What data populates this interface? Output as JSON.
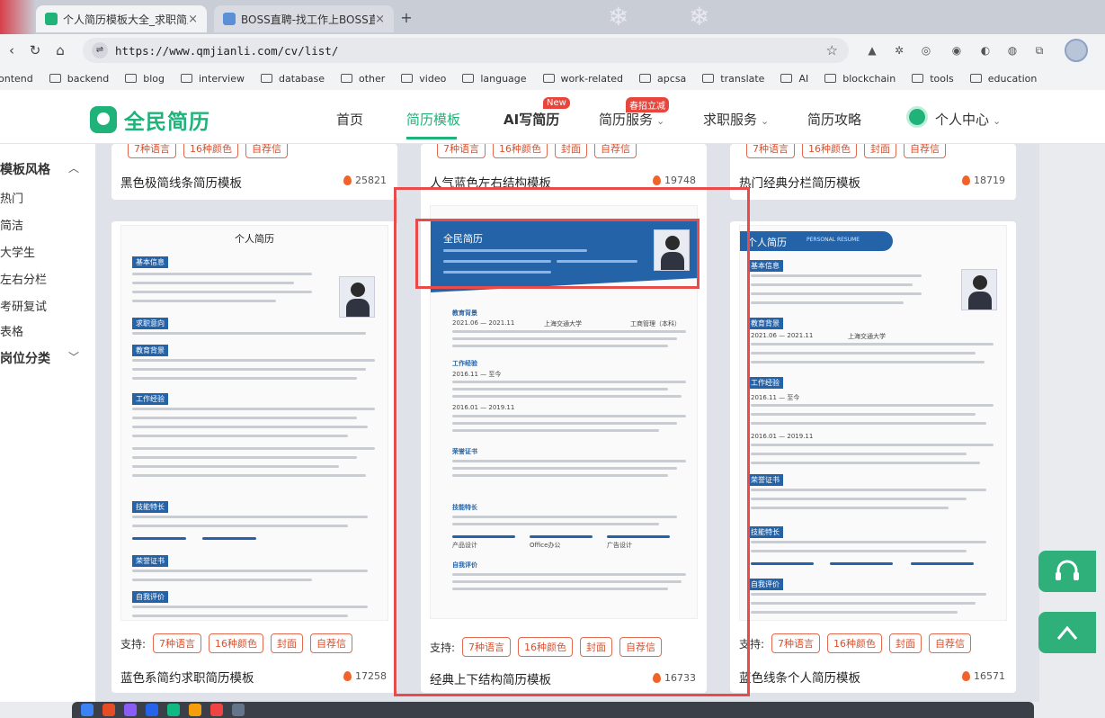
{
  "browser": {
    "tabs": [
      {
        "title": "个人简历模板大全_求职简历模",
        "active": true
      },
      {
        "title": "BOSS直聘-找工作上BOSS直",
        "active": false
      }
    ],
    "url": "https://www.qmjianli.com/cv/list/",
    "bookmarks": [
      "ontend",
      "backend",
      "blog",
      "interview",
      "database",
      "other",
      "video",
      "language",
      "work-related",
      "apcsa",
      "translate",
      "AI",
      "blockchain",
      "tools",
      "education"
    ]
  },
  "site": {
    "logo": "全民简历",
    "nav": [
      {
        "label": "首页"
      },
      {
        "label": "简历模板"
      },
      {
        "label": "AI写简历"
      },
      {
        "label": "简历服务"
      },
      {
        "label": "求职服务"
      },
      {
        "label": "简历攻略"
      },
      {
        "label": "个人中心"
      }
    ],
    "badge_new": "New",
    "badge_spring": "春招立减"
  },
  "sidebar": {
    "section1": "模板风格",
    "items": [
      "热门",
      "简洁",
      "大学生",
      "左右分栏",
      "考研复试",
      "表格"
    ],
    "section2": "岗位分类"
  },
  "support_label": "支持:",
  "chips": [
    "7种语言",
    "16种颜色",
    "封面",
    "自荐信"
  ],
  "top_cards": [
    {
      "title": "黑色极简线条简历模板",
      "count": "25821"
    },
    {
      "title": "人气蓝色左右结构模板",
      "count": "19748"
    },
    {
      "title": "热门经典分栏简历模板",
      "count": "18719"
    }
  ],
  "cards": [
    {
      "title": "蓝色系简约求职简历模板",
      "count": "17258",
      "preview_name": "个人简历"
    },
    {
      "title": "经典上下结构简历模板",
      "count": "16733",
      "preview_name": "全民简历"
    },
    {
      "title": "蓝色线条个人简历模板",
      "count": "16571",
      "preview_name": "个人简历"
    }
  ],
  "preview_center": {
    "sections": [
      "教育背景",
      "工作经验",
      "荣誉证书",
      "技能特长",
      "自我评价"
    ],
    "edu_line": "2021.06 — 2021.11",
    "school": "上海交通大学",
    "major": "工商管理（本科）",
    "work1": "2016.11 — 至今",
    "work2": "2016.01 — 2019.11",
    "skills": [
      "产品设计",
      "Office办公",
      "广告设计"
    ]
  },
  "preview_left": {
    "sections": [
      "基本信息",
      "求职意向",
      "教育背景",
      "工作经验",
      "技能特长",
      "荣誉证书",
      "自我评价"
    ]
  },
  "preview_right": {
    "subtitle": "PERSONAL RESUME",
    "sections": [
      "基本信息",
      "教育背景",
      "工作经验",
      "荣誉证书",
      "技能特长",
      "自我评价"
    ],
    "edu_line": "2021.06 — 2021.11",
    "school": "上海交通大学",
    "work1": "2016.11 — 至今",
    "work2": "2016.01 — 2019.11"
  },
  "colors": {
    "brand": "#1fb37a",
    "highlight": "#e94b4b",
    "resume_blue": "#2563a8"
  }
}
